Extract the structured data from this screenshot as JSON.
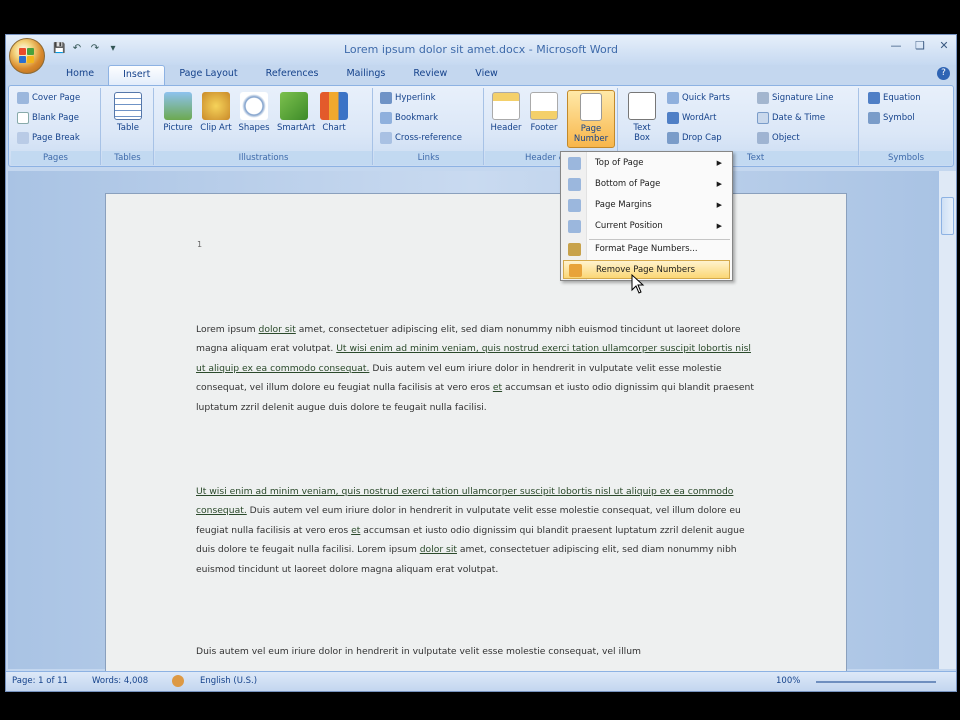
{
  "window": {
    "title": "Lorem ipsum dolor sit amet.docx - Microsoft Word"
  },
  "qat": {
    "save_icon": "save-icon",
    "undo_icon": "undo-icon",
    "redo_icon": "redo-icon",
    "more_icon": "customize-icon"
  },
  "tabs": [
    {
      "label": "Home"
    },
    {
      "label": "Insert"
    },
    {
      "label": "Page Layout"
    },
    {
      "label": "References"
    },
    {
      "label": "Mailings"
    },
    {
      "label": "Review"
    },
    {
      "label": "View"
    }
  ],
  "ribbon": {
    "pages": {
      "label": "Pages",
      "cover": "Cover Page",
      "blank": "Blank Page",
      "break": "Page Break"
    },
    "tables": {
      "label": "Tables",
      "table": "Table"
    },
    "illustrations": {
      "label": "Illustrations",
      "picture": "Picture",
      "clipart": "Clip Art",
      "shapes": "Shapes",
      "smartart": "SmartArt",
      "chart": "Chart"
    },
    "links": {
      "label": "Links",
      "hyperlink": "Hyperlink",
      "bookmark": "Bookmark",
      "crossref": "Cross-reference"
    },
    "headerfooter": {
      "label": "Header & F",
      "header": "Header",
      "footer": "Footer",
      "pagenumber": "Page Number"
    },
    "text": {
      "label": "Text",
      "textbox": "Text Box",
      "quickparts": "Quick Parts",
      "wordart": "WordArt",
      "dropcap": "Drop Cap",
      "signature": "Signature Line",
      "datetime": "Date & Time",
      "object": "Object"
    },
    "symbols": {
      "label": "Symbols",
      "equation": "Equation",
      "symbol": "Symbol"
    }
  },
  "menu": {
    "items": [
      {
        "label": "Top of Page"
      },
      {
        "label": "Bottom of Page"
      },
      {
        "label": "Page Margins"
      },
      {
        "label": "Current Position"
      },
      {
        "label": "Format Page Numbers..."
      },
      {
        "label": "Remove Page Numbers"
      }
    ]
  },
  "doc": {
    "marker": "1",
    "p1_a": "Lorem ipsum ",
    "p1_u1": "dolor sit",
    "p1_b": " amet, consectetuer adipiscing elit, sed diam nonummy nibh euismod tincidunt ut laoreet dolore magna aliquam erat volutpat. ",
    "p1_u2": "Ut wisi enim ad minim veniam, quis nostrud exerci tation ullamcorper suscipit lobortis nisl ut aliquip ex ea commodo consequat.",
    "p1_c": " Duis autem vel eum iriure dolor in hendrerit in vulputate velit esse molestie consequat, vel illum dolore eu feugiat nulla facilisis at vero eros ",
    "p1_u3": "et",
    "p1_d": " accumsan et iusto odio dignissim qui blandit praesent luptatum zzril delenit augue duis dolore te feugait nulla facilisi.",
    "p2_u1": "Ut wisi enim ad minim veniam, quis nostrud exerci tation ullamcorper suscipit lobortis nisl ut aliquip ex ea commodo consequat.",
    "p2_a": " Duis autem vel eum iriure dolor in hendrerit in vulputate velit esse molestie consequat, vel illum dolore eu feugiat nulla facilisis at vero eros ",
    "p2_u2": "et",
    "p2_b": " accumsan et iusto odio dignissim qui blandit praesent luptatum zzril delenit augue duis dolore te feugait nulla facilisi. Lorem ipsum ",
    "p2_u3": "dolor sit",
    "p2_c": " amet, consectetuer adipiscing elit, sed diam nonummy nibh euismod tincidunt ut laoreet dolore magna aliquam erat volutpat.",
    "p3": "Duis autem vel eum iriure dolor in hendrerit in vulputate velit esse molestie consequat, vel illum"
  },
  "status": {
    "page": "Page: 1 of 11",
    "words": "Words: 4,008",
    "language": "English (U.S.)",
    "zoom": "100%"
  }
}
